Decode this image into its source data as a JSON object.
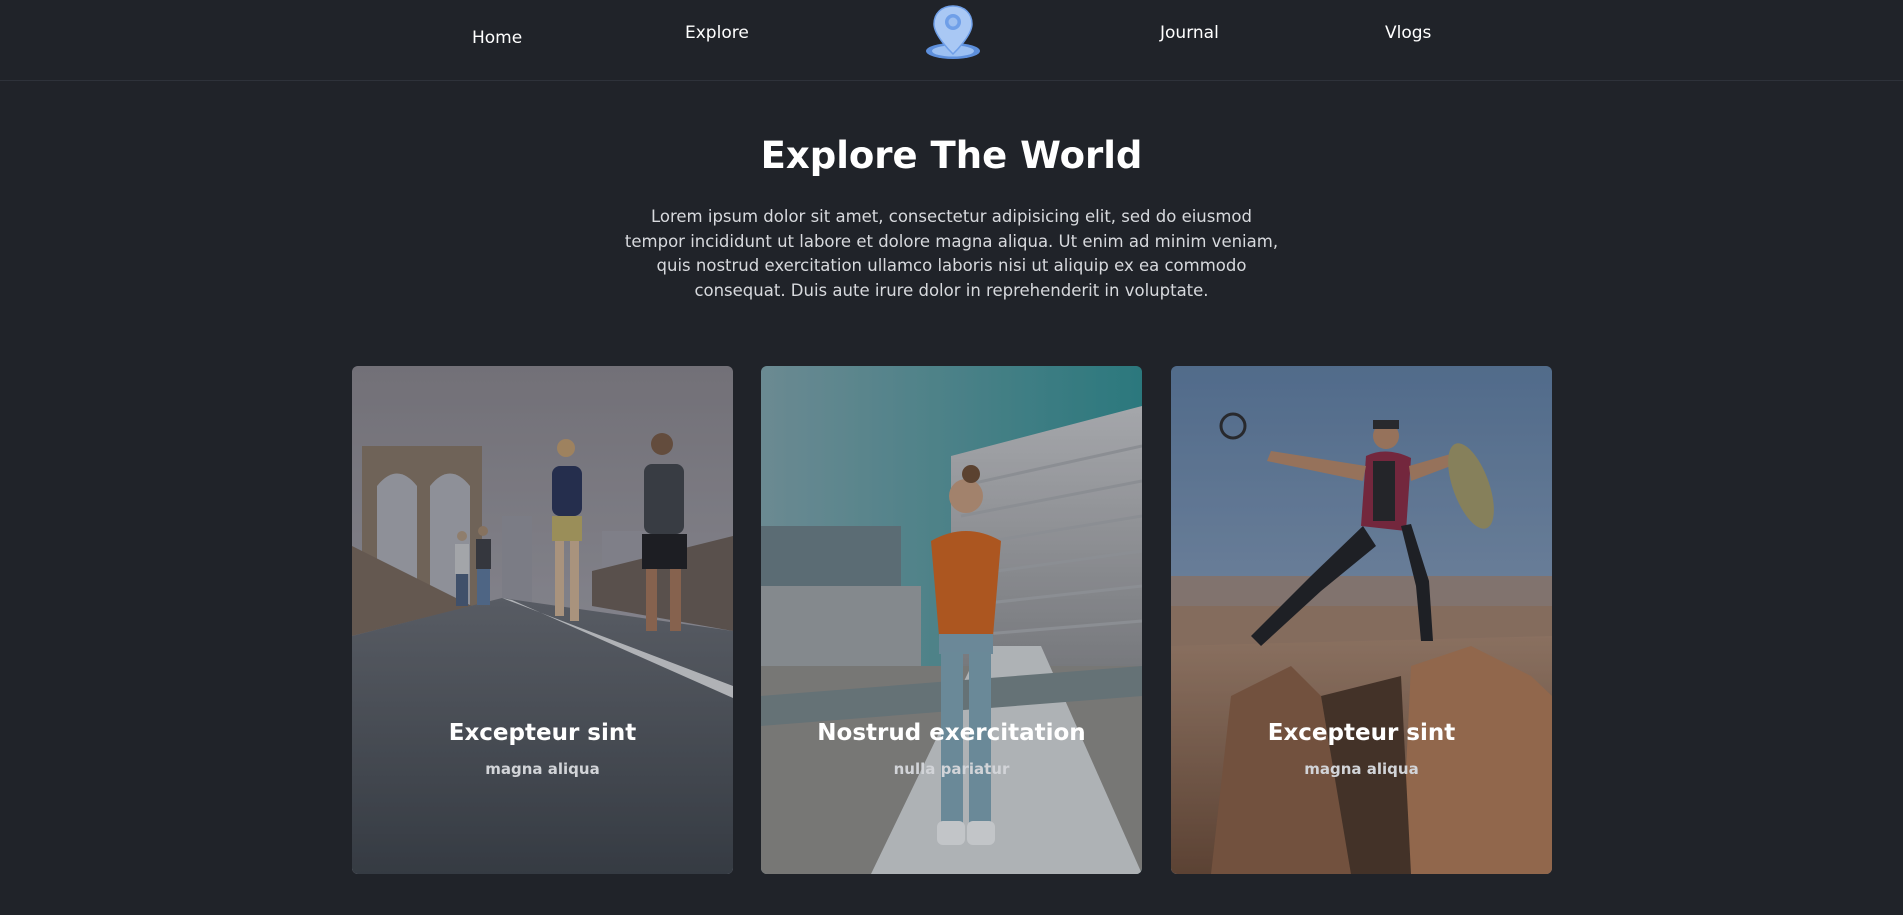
{
  "nav": {
    "items": [
      {
        "label": "Home"
      },
      {
        "label": "Explore"
      },
      {
        "label": "Journal"
      },
      {
        "label": "Vlogs"
      }
    ],
    "logo_icon": "map-pin-icon"
  },
  "hero": {
    "title": "Explore The World",
    "description": "Lorem ipsum dolor sit amet, consectetur adipisicing elit, sed do eiusmod tempor incididunt ut labore et dolore magna aliqua. Ut enim ad minim veniam, quis nostrud exercitation ullamco laboris nisi ut aliquip ex ea commodo consequat. Duis aute irure dolor in reprehenderit in voluptate."
  },
  "cards": [
    {
      "title": "Excepteur sint",
      "subtitle": "magna aliqua"
    },
    {
      "title": "Nostrud exercitation",
      "subtitle": "nulla pariatur"
    },
    {
      "title": "Excepteur sint",
      "subtitle": "magna aliqua"
    }
  ],
  "colors": {
    "background": "#202329",
    "text": "#ffffff",
    "muted_text": "#d7d9dd",
    "logo_blue": "#6f9fe8"
  }
}
